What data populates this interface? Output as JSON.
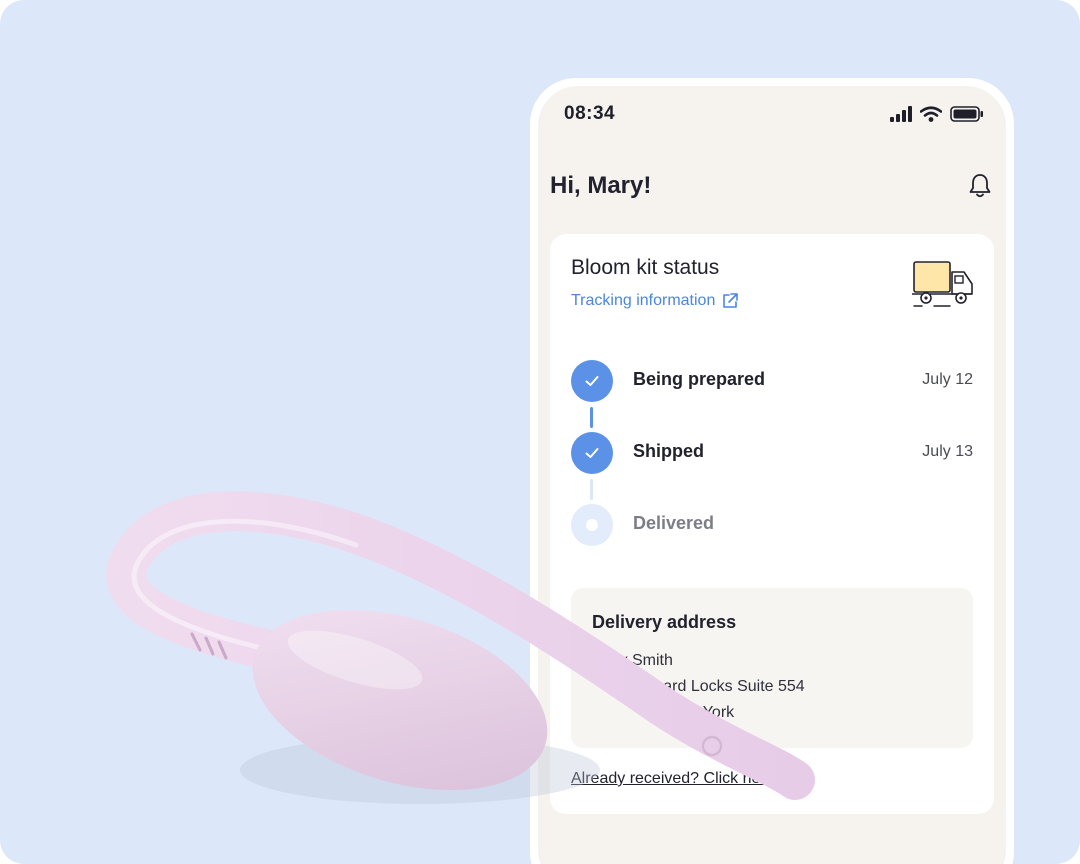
{
  "status_bar": {
    "time": "08:34"
  },
  "header": {
    "greeting": "Hi, Mary!"
  },
  "kit_card": {
    "title": "Bloom kit status",
    "tracking_link": "Tracking information",
    "steps": [
      {
        "label": "Being prepared",
        "date": "July 12",
        "state": "done"
      },
      {
        "label": "Shipped",
        "date": "July 13",
        "state": "done"
      },
      {
        "label": "Delivered",
        "date": "",
        "state": "pending"
      }
    ],
    "address": {
      "title": "Delivery address",
      "name": "Mary Smith",
      "line1": "Hildgegard Locks Suite 554",
      "line2": "A, New York"
    },
    "received_link": "Already received? Click here"
  },
  "icons": {
    "bell": "bell-icon",
    "external": "external-link-icon",
    "truck": "delivery-truck-icon",
    "check": "check-icon",
    "signal": "cellular-signal-icon",
    "wifi": "wifi-icon",
    "battery": "battery-icon"
  },
  "colors": {
    "background": "#dce8fa",
    "accent": "#5b91e6",
    "link": "#4a86e0",
    "product": "#ecd6ec"
  }
}
